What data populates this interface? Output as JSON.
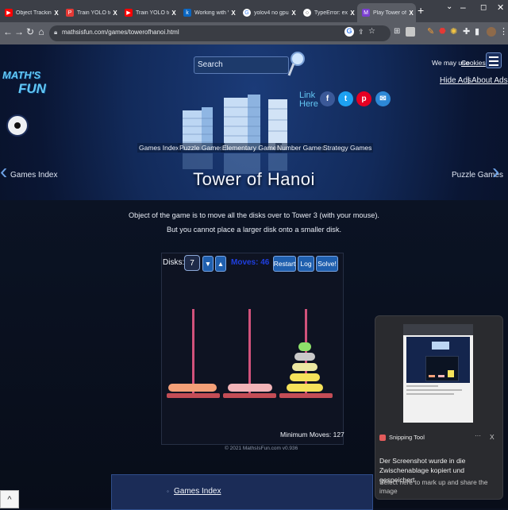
{
  "browser": {
    "tabs": [
      {
        "title": "Object Tracking fr",
        "favicon_color": "#ff0000",
        "favicon_glyph": "▶"
      },
      {
        "title": "Train YOLO to dete",
        "favicon_color": "#e53935",
        "favicon_glyph": "P"
      },
      {
        "title": "Train YOLO to dete",
        "favicon_color": "#ff0000",
        "favicon_glyph": "▶"
      },
      {
        "title": "Working with Vide",
        "favicon_color": "#0a66c2",
        "favicon_glyph": "k"
      },
      {
        "title": "yolov4 no gpu - G",
        "favicon_color": "#ffffff",
        "favicon_glyph": "G"
      },
      {
        "title": "TypeError: expecte",
        "favicon_color": "#ffffff",
        "favicon_glyph": "○"
      },
      {
        "title": "Play Tower of Hano",
        "favicon_color": "#7a3fd1",
        "favicon_glyph": "M"
      }
    ],
    "new_tab": "+",
    "url": "mathsisfun.com/games/towerofhanoi.html"
  },
  "site": {
    "logo_line1": "MATH'S",
    "logo_line2": "FUN",
    "search_placeholder": "Search",
    "cookie_notice": "We may use",
    "cookie_link": "Cookies",
    "hide_ads": "Hide Ads",
    "about_ads": "About Ads",
    "link_here_line1": "Link",
    "link_here_line2": "Here",
    "nav_links": [
      "Games Index",
      "Puzzle Games",
      "Elementary Games",
      "Number Games",
      "Strategy Games"
    ],
    "prev_page": "Games Index",
    "next_page": "Puzzle Games",
    "page_title": "Tower of Hanoi",
    "desc_line1": "Object of the game is to move all the disks over to Tower 3 (with your mouse).",
    "desc_line2": "But you cannot place a larger disk onto a smaller disk.",
    "copyright": "© 2021 MathsIsFun.com v0.936",
    "footer_link": "Games Index"
  },
  "game": {
    "disks_label": "Disks:",
    "disks_value": "7",
    "moves_label": "Moves: 46",
    "restart": "Restart",
    "log": "Log",
    "solve": "Solve!",
    "minimum_moves": "Minimum Moves: 127",
    "tower_colors": [
      "#f4a078",
      "#f2b4b8",
      "#f5e25a"
    ]
  },
  "toast": {
    "app_name": "Snipping Tool",
    "more": "···",
    "close": "X",
    "message": "Der Screenshot wurde in die Zwischenablage kopiert und gespeichert",
    "hint": "Select here to mark up and share the image"
  },
  "bottom": {
    "caret": "^"
  }
}
